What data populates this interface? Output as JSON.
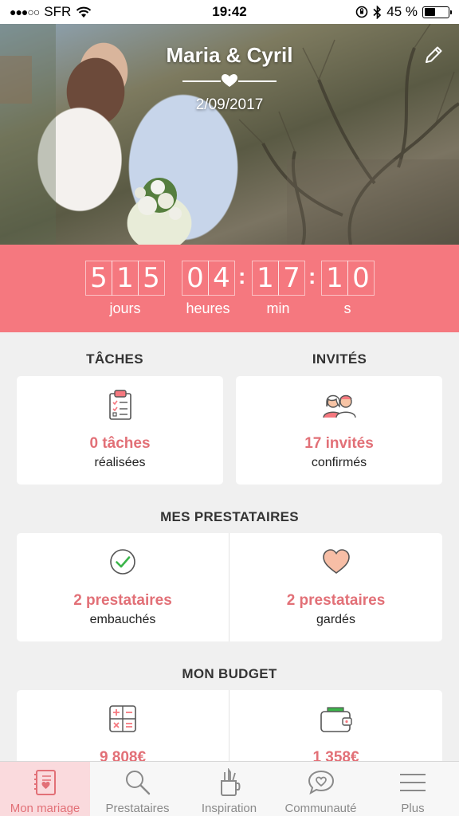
{
  "status_bar": {
    "signal": "●●●○○",
    "carrier": "SFR",
    "time": "19:42",
    "battery_percent": "45 %",
    "battery_level": 0.45
  },
  "hero": {
    "couple": "Maria & Cyril",
    "date": "2/09/2017"
  },
  "countdown": {
    "days_digits": [
      "5",
      "1",
      "5"
    ],
    "hours_digits": [
      "0",
      "4"
    ],
    "minutes_digits": [
      "1",
      "7"
    ],
    "seconds_digits": [
      "1",
      "0"
    ],
    "days_label": "jours",
    "hours_label": "heures",
    "minutes_label": "min",
    "seconds_label": "s",
    "separator": ":"
  },
  "tasks": {
    "title": "TÂCHES",
    "value": "0 tâches",
    "sub": "réalisées"
  },
  "guests": {
    "title": "INVITÉS",
    "value": "17 invités",
    "sub": "confirmés"
  },
  "vendors": {
    "title": "MES PRESTATAIRES",
    "hired_value": "2 prestataires",
    "hired_sub": "embauchés",
    "saved_value": "2 prestataires",
    "saved_sub": "gardés"
  },
  "budget": {
    "title": "MON BUDGET",
    "estimated_value": "9 808€",
    "spent_value": "1 358€"
  },
  "tab_bar": {
    "items": [
      {
        "label": "Mon mariage",
        "icon": "notebook-icon",
        "active": true
      },
      {
        "label": "Prestataires",
        "icon": "search-icon",
        "active": false
      },
      {
        "label": "Inspiration",
        "icon": "pencil-cup-icon",
        "active": false
      },
      {
        "label": "Communauté",
        "icon": "chat-heart-icon",
        "active": false
      },
      {
        "label": "Plus",
        "icon": "menu-icon",
        "active": false
      }
    ]
  },
  "colors": {
    "accent": "#f5787f",
    "accent_text": "#e27077",
    "background": "#f0f0f0",
    "active_tab": "#fadadd"
  }
}
